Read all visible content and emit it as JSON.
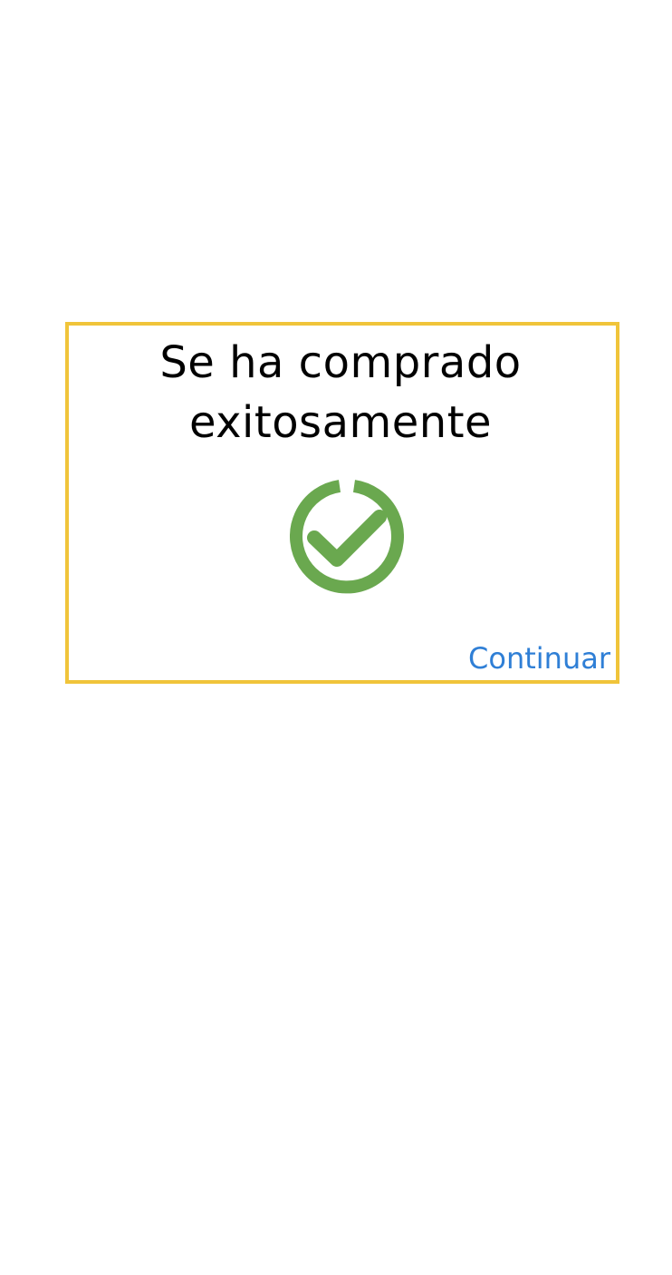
{
  "dialog": {
    "title_line1": "Se ha comprado",
    "title_line2": "exitosamente",
    "success_icon": "check-circle-icon",
    "continue_label": "Continuar"
  },
  "colors": {
    "border": "#f0c43a",
    "check": "#6aa84f",
    "link": "#2f7fd6",
    "text": "#000000",
    "background": "#ffffff"
  }
}
